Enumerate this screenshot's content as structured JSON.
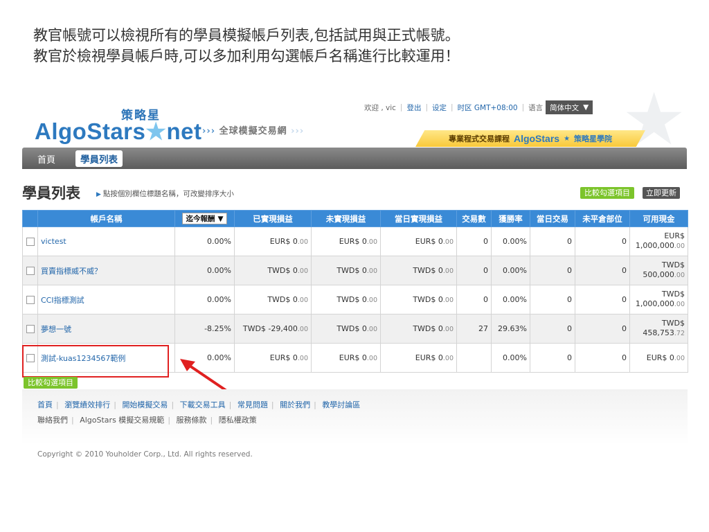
{
  "caption": {
    "line1": "教官帳號可以檢視所有的學員模擬帳戶列表,包括試用與正式帳號。",
    "line2": "教官於檢視學員帳戶時,可以多加利用勾選帳戶名稱進行比較運用！"
  },
  "logo": {
    "cn": "策略星",
    "en_main": "AlgoStars",
    "en_star": "★",
    "en_tail": "net"
  },
  "slogan": {
    "arrows_left": "›››",
    "text": "全球模擬交易網",
    "arrows_right": "›››"
  },
  "topnav": {
    "welcome": "欢迎 , vic",
    "logout": "登出",
    "settings": "设定",
    "timezone": "时区 GMT+08:00",
    "language_label": "语言",
    "language_value": "简体中文"
  },
  "promo": {
    "text": "專業程式交易課程",
    "brand": "AlgoStars",
    "school": "策略星學院"
  },
  "nav": {
    "home": "首頁",
    "student_list": "學員列表"
  },
  "section": {
    "title": "學員列表",
    "hint": "點按個別欄位標題名稱，可改變排序大小",
    "compare_btn": "比較勾選項目",
    "refresh_btn": "立即更新"
  },
  "table": {
    "headers": {
      "account": "帳戶名稱",
      "sort_select": "迄今報酬",
      "realized": "已實現損益",
      "unrealized": "未實現損益",
      "daily_realized": "當日實現損益",
      "trades": "交易數",
      "win_rate": "獲勝率",
      "daily_trades": "當日交易",
      "open_positions": "未平倉部位",
      "cash": "可用現金"
    },
    "rows": [
      {
        "name": "victest",
        "return": "0.00%",
        "realized": "EUR$ 0",
        "realized_dec": ".00",
        "unrealized": "EUR$ 0",
        "unrealized_dec": ".00",
        "daily": "EUR$ 0",
        "daily_dec": ".00",
        "trades": "0",
        "win_rate": "0.00%",
        "daily_trades": "0",
        "open": "0",
        "cash_cur": "EUR$",
        "cash_int": "1,000,000",
        "cash_dec": ".00"
      },
      {
        "name": "買賣指標威不威？",
        "return": "0.00%",
        "realized": "TWD$ 0",
        "realized_dec": ".00",
        "unrealized": "TWD$ 0",
        "unrealized_dec": ".00",
        "daily": "TWD$ 0",
        "daily_dec": ".00",
        "trades": "0",
        "win_rate": "0.00%",
        "daily_trades": "0",
        "open": "0",
        "cash_cur": "TWD$",
        "cash_int": "500,000",
        "cash_dec": ".00"
      },
      {
        "name": "CCI指標測試",
        "return": "0.00%",
        "realized": "TWD$ 0",
        "realized_dec": ".00",
        "unrealized": "TWD$ 0",
        "unrealized_dec": ".00",
        "daily": "TWD$ 0",
        "daily_dec": ".00",
        "trades": "0",
        "win_rate": "0.00%",
        "daily_trades": "0",
        "open": "0",
        "cash_cur": "TWD$",
        "cash_int": "1,000,000",
        "cash_dec": ".00"
      },
      {
        "name": "夢想一號",
        "return": "-8.25%",
        "realized": "TWD$ -29,400",
        "realized_dec": ".00",
        "unrealized": "TWD$ 0",
        "unrealized_dec": ".00",
        "daily": "TWD$ 0",
        "daily_dec": ".00",
        "trades": "27",
        "win_rate": "29.63%",
        "daily_trades": "0",
        "open": "0",
        "cash_cur": "TWD$",
        "cash_int": "458,753",
        "cash_dec": ".72"
      },
      {
        "name": "測試-kuas1234567範例",
        "return": "0.00%",
        "realized": "EUR$ 0",
        "realized_dec": ".00",
        "unrealized": "EUR$ 0",
        "unrealized_dec": ".00",
        "daily": "EUR$ 0",
        "daily_dec": ".00",
        "trades": "",
        "win_rate": "0.00%",
        "daily_trades": "0",
        "open": "0",
        "cash_cur": "",
        "cash_int": "EUR$ 0",
        "cash_dec": ".00"
      }
    ]
  },
  "footer": {
    "row1": [
      "首頁",
      "瀏覽績效排行",
      "開始模擬交易",
      "下載交易工具",
      "常見問題",
      "關於我們",
      "教學討論區"
    ],
    "row2": [
      "聯絡我們",
      "AlgoStars 模擬交易規範",
      "服務條款",
      "隱私權政策"
    ],
    "copyright": "Copyright © 2010 Youholder Corp., Ltd. All rights reserved."
  },
  "colors": {
    "header_blue": "#3a8ad6",
    "brand_blue": "#2d79bf",
    "green_button": "#7cc42b",
    "highlight_red": "#e02020"
  }
}
